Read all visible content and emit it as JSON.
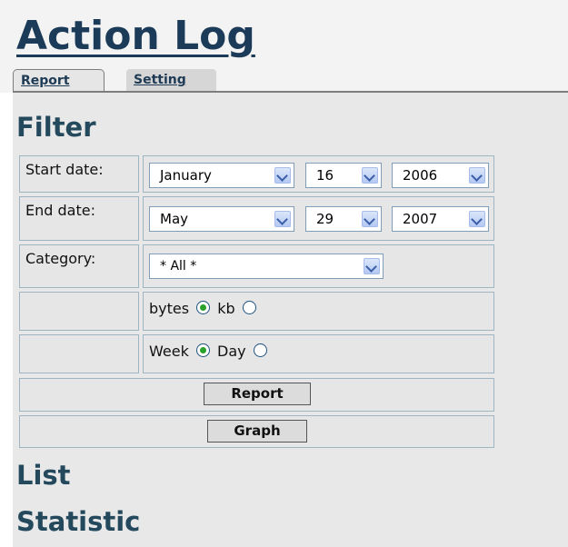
{
  "app_title": "Action Log",
  "tabs": [
    {
      "label": "Report",
      "active": true
    },
    {
      "label": "Setting",
      "active": false
    }
  ],
  "filter": {
    "heading": "Filter",
    "start_date": {
      "label": "Start date:",
      "month": "January",
      "day": "16",
      "year": "2006"
    },
    "end_date": {
      "label": "End date:",
      "month": "May",
      "day": "29",
      "year": "2007"
    },
    "category": {
      "label": "Category:",
      "value": "* All *"
    },
    "unit": {
      "options": [
        "bytes",
        "kb"
      ],
      "selected": "bytes"
    },
    "period": {
      "options": [
        "Week",
        "Day"
      ],
      "selected": "Week"
    },
    "report_button": "Report",
    "graph_button": "Graph"
  },
  "sections": {
    "list": "List",
    "statistic": "Statistic"
  },
  "colors": {
    "heading": "#1c3b59",
    "panel": "#e8e8e8",
    "cell_border": "#9fb5c4",
    "radio_dot": "#2aa12a"
  }
}
